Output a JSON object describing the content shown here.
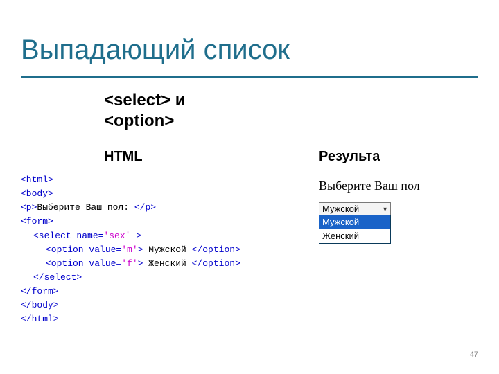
{
  "slide": {
    "title": "Выпадающий список",
    "subtitle_line1": "<select> и",
    "subtitle_line2": "<option>",
    "col_html": "HTML",
    "col_result": "Результа",
    "page_number": "47"
  },
  "code": {
    "l1": "<html>",
    "l2": "<body>",
    "l3_a": "<p>",
    "l3_txt": "Выберите Ваш пол: ",
    "l3_b": "</p>",
    "l4": "<form>",
    "l5_a": "<select name=",
    "l5_v": "'sex'",
    "l5_b": " >",
    "l6_a": "<option value=",
    "l6_v": "'m'",
    "l6_b": ">",
    "l6_t": " Мужской ",
    "l6_c": "</option>",
    "l7_a": "<option value=",
    "l7_v": "'f'",
    "l7_b": ">",
    "l7_t": " Женский ",
    "l7_c": "</option>",
    "l8": "</select>",
    "l9": "</form>",
    "l10": "</body>",
    "l11": "</html>"
  },
  "result": {
    "prompt": "Выберите Ваш пол",
    "selected": "Мужской",
    "option1": "Мужской",
    "option2": "Женский"
  }
}
